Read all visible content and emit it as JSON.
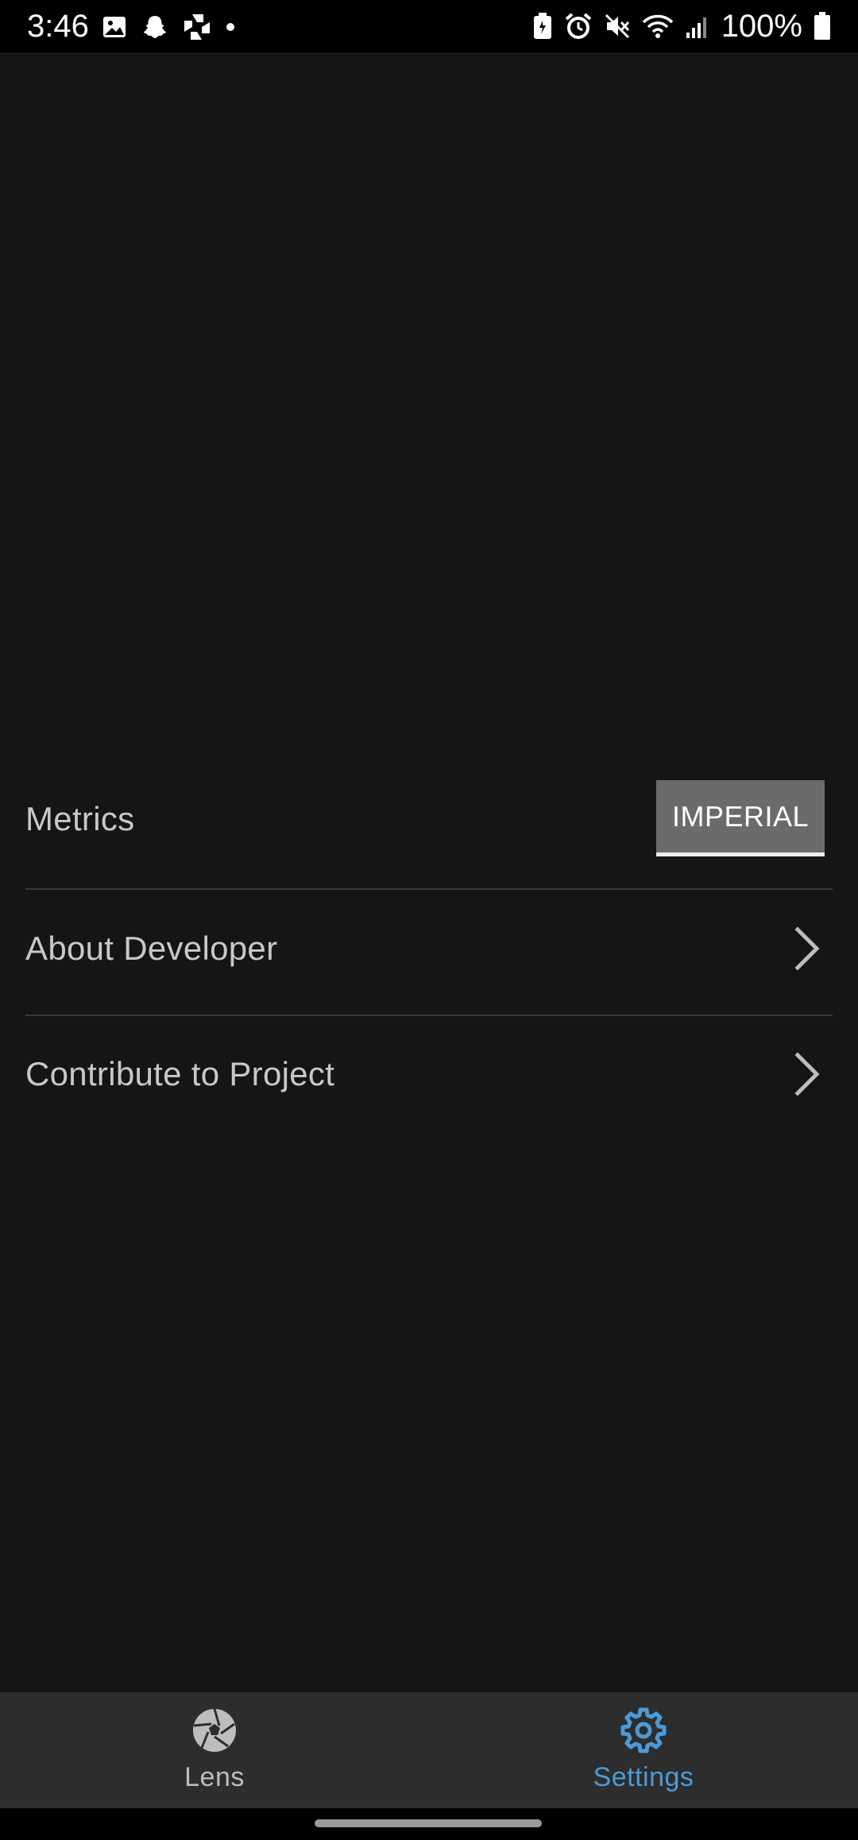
{
  "status_bar": {
    "time": "3:46",
    "battery": "100%",
    "left_icons": [
      "image-icon",
      "snapchat-icon",
      "bank-app-icon",
      "dot-icon"
    ],
    "right_icons": [
      "battery-saver-icon",
      "alarm-icon",
      "mute-icon",
      "wifi-icon",
      "signal-icon",
      "battery-icon"
    ]
  },
  "settings": {
    "metrics": {
      "label": "Metrics",
      "button_label": "IMPERIAL"
    },
    "about": {
      "label": "About Developer",
      "icon": "chevron-right-icon"
    },
    "contribute": {
      "label": "Contribute to Project",
      "icon": "chevron-right-icon"
    }
  },
  "tab_bar": {
    "lens": {
      "label": "Lens",
      "icon": "aperture-icon"
    },
    "settings": {
      "label": "Settings",
      "icon": "gear-icon",
      "active": true
    }
  },
  "colors": {
    "background": "#151515",
    "accent": "#4c9bd6",
    "tab_bar": "#2d2d2d",
    "button": "#6b6b6b"
  }
}
